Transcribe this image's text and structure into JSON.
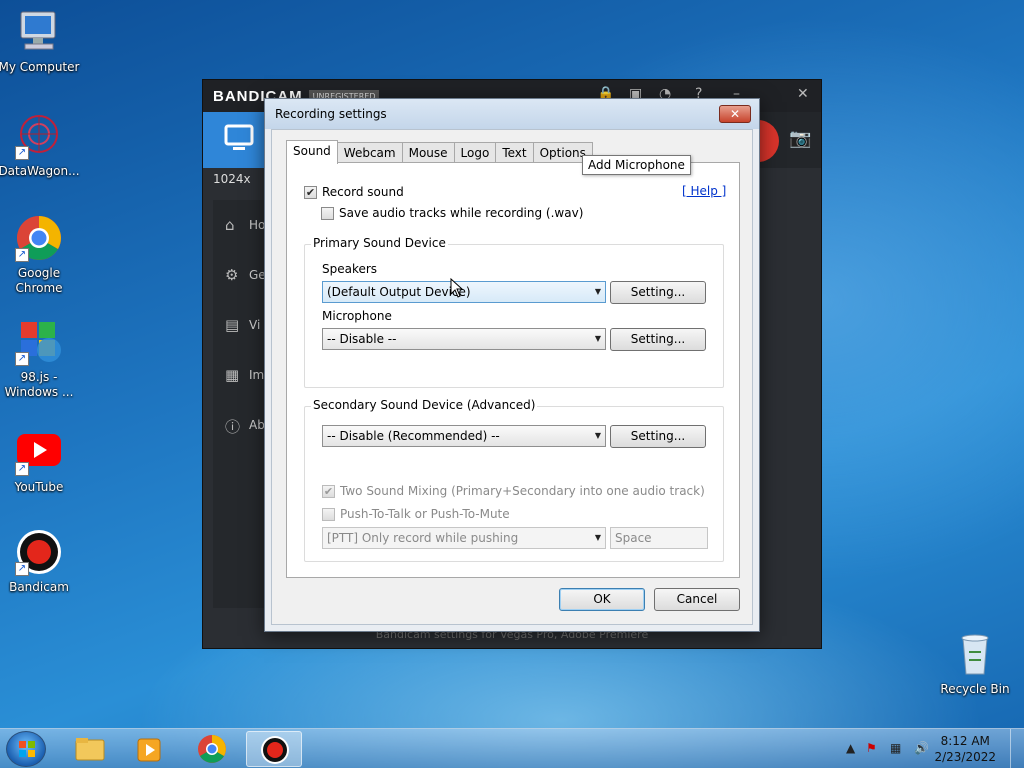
{
  "desktop_icons": [
    {
      "label": "My Computer"
    },
    {
      "label": "DataWagon..."
    },
    {
      "label": "Google Chrome"
    },
    {
      "label": "98.js - Windows ..."
    },
    {
      "label": "YouTube"
    },
    {
      "label": "Bandicam"
    },
    {
      "label": "Recycle Bin"
    }
  ],
  "bandicam": {
    "logo": "BANDICAM",
    "badge": "UNREGISTERED",
    "resolution": "1024x",
    "sidebar": [
      {
        "label": "Ho",
        "icon": "home-icon"
      },
      {
        "label": "Ge",
        "icon": "gear-icon"
      },
      {
        "label": "Vi",
        "icon": "video-icon"
      },
      {
        "label": "Im",
        "icon": "image-icon"
      },
      {
        "label": "Ab",
        "icon": "info-icon"
      }
    ],
    "footer_text": "Bandicam settings for Vegas Pro, Adobe Premiere"
  },
  "dialog": {
    "title": "Recording settings",
    "tabs": [
      "Sound",
      "Webcam",
      "Mouse",
      "Logo",
      "Text",
      "Options"
    ],
    "active_tab": "Sound",
    "record_sound_label": "Record sound",
    "record_sound_checked": true,
    "save_tracks_label": "Save audio tracks while recording (.wav)",
    "save_tracks_checked": false,
    "help_link": "[ Help ]",
    "primary_group": "Primary Sound Device",
    "speakers_label": "Speakers",
    "speakers_value": "(Default Output Device)",
    "microphone_label": "Microphone",
    "microphone_value": "-- Disable --",
    "setting_button": "Setting...",
    "secondary_group": "Secondary Sound Device (Advanced)",
    "secondary_value": "-- Disable (Recommended) --",
    "two_sound_mixing_label": "Two Sound Mixing (Primary+Secondary into one audio track)",
    "two_sound_mixing_checked": true,
    "ptt_label": "Push-To-Talk or Push-To-Mute",
    "ptt_checked": false,
    "ptt_mode_value": "[PTT] Only record while pushing",
    "ptt_key_value": "Space",
    "ok_button": "OK",
    "cancel_button": "Cancel",
    "tooltip": "Add Microphone"
  },
  "taskbar": {
    "time": "8:12 AM",
    "date": "2/23/2022"
  }
}
